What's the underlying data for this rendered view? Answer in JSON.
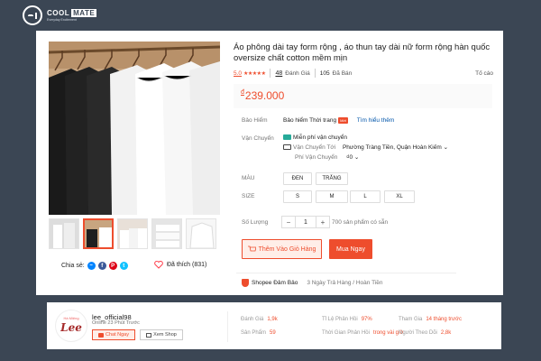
{
  "brand": {
    "name_left": "COOL",
    "name_right": "MATE",
    "tagline": "Everyday Excitement"
  },
  "colors": {
    "accent": "#ee4d2d",
    "header_bg": "#3b4654",
    "teal": "#26aa99"
  },
  "product": {
    "title": "Áo phông dài tay form rộng , áo thun tay dài nữ form rộng hàn quốc oversize chất cotton mềm mịn",
    "rating": "5.0",
    "stars": "★★★★★",
    "reviews_count": "48",
    "reviews_label": "Đánh Giá",
    "sold_count": "105",
    "sold_label": "Đã Bán",
    "report": "Tố cáo",
    "currency": "đ",
    "price": "239.000",
    "insurance_label": "Bảo Hiểm",
    "insurance_text": "Bảo hiểm Thời trang",
    "insurance_badge": "Mới",
    "insurance_link": "Tìm hiểu thêm",
    "shipping_label": "Vận Chuyển",
    "free_ship": "Miễn phí vận chuyển",
    "ship_to_label": "Vận Chuyển Tới",
    "ship_to_value": "Phường Tràng Tiền, Quận Hoàn Kiếm",
    "ship_fee_label": "Phí Vận Chuyển",
    "ship_fee_value": "₫0",
    "color_label": "MÀU",
    "colors": [
      "ĐEN",
      "TRẮNG"
    ],
    "size_label": "SIZE",
    "sizes": [
      "S",
      "M",
      "L",
      "XL"
    ],
    "qty_label": "Số Lượng",
    "qty_minus": "−",
    "qty_value": "1",
    "qty_plus": "+",
    "stock_text": "700 sản phẩm có sẵn",
    "add_to_cart": "Thêm Vào Giỏ Hàng",
    "buy_now": "Mua Ngay",
    "guarantee_title": "Shopee Đảm Bảo",
    "guarantee_text": "3 Ngày Trả Hàng / Hoàn Tiền",
    "share_label": "Chia sẻ:",
    "like_label": "Đã thích (831)"
  },
  "share_icons": [
    "messenger-icon",
    "facebook-icon",
    "pinterest-icon",
    "twitter-icon"
  ],
  "shop": {
    "logo_small": "Hà Miệng",
    "logo_main": "Lee",
    "name": "lee_official98",
    "online": "Online 23 Phút Trước",
    "chat_btn": "Chat Ngay",
    "view_shop_btn": "Xem Shop",
    "stats": [
      {
        "label": "Đánh Giá",
        "value": "1,9k"
      },
      {
        "label": "Sản Phẩm",
        "value": "59"
      },
      {
        "label": "Tỉ Lệ Phản Hồi",
        "value": "97%"
      },
      {
        "label": "Thời Gian Phản Hồi",
        "value": "trong vài giờ"
      },
      {
        "label": "Tham Gia",
        "value": "14 tháng trước"
      },
      {
        "label": "Người Theo Dõi",
        "value": "2,8k"
      }
    ]
  }
}
